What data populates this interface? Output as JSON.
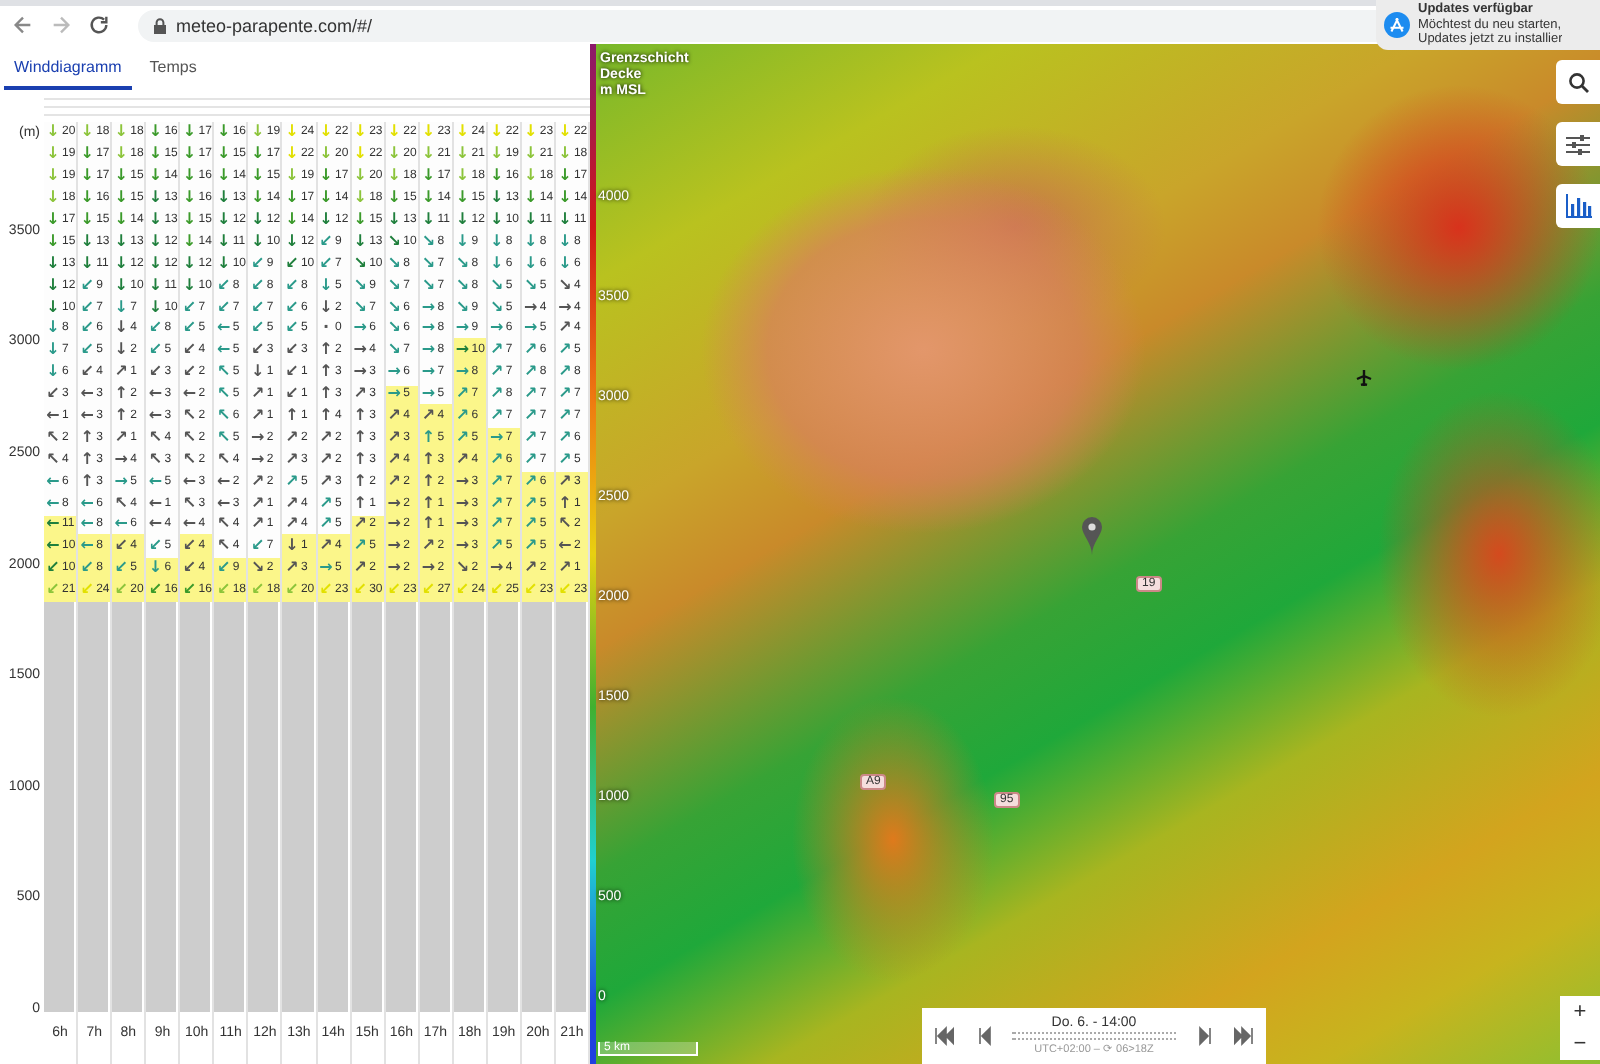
{
  "browser": {
    "url": "meteo-parapente.com/#/"
  },
  "notification": {
    "title": "Updates verfügbar",
    "lines": [
      "Möchtest du neu starten,",
      "Updates jetzt zu installier"
    ]
  },
  "wind_diagram": {
    "tabs": [
      {
        "label": "Winddiagramm",
        "selected": true
      },
      {
        "label": "Temps",
        "selected": false
      }
    ],
    "unit": "(m)",
    "y_ticks": [
      "3500",
      "3000",
      "2500",
      "2000",
      "1500",
      "1000",
      "500",
      "0"
    ],
    "columns": [
      {
        "hour": "6h",
        "level": 0.18
      },
      {
        "hour": "7h",
        "level": 0.14
      },
      {
        "hour": "8h",
        "level": 0.14
      },
      {
        "hour": "9h",
        "level": 0.09
      },
      {
        "hour": "10h",
        "level": 0.14
      },
      {
        "hour": "11h",
        "level": 0.09
      },
      {
        "hour": "12h",
        "level": 0.09
      },
      {
        "hour": "13h",
        "level": 0.14
      },
      {
        "hour": "14h",
        "level": 0.14
      },
      {
        "hour": "15h",
        "level": 0.18
      },
      {
        "hour": "16h",
        "level": 0.45
      },
      {
        "hour": "17h",
        "level": 0.41
      },
      {
        "hour": "18h",
        "level": 0.55
      },
      {
        "hour": "19h",
        "level": 0.36
      },
      {
        "hour": "20h",
        "level": 0.27
      },
      {
        "hour": "21h",
        "level": 0.27
      }
    ],
    "rows": [
      {
        "values": [
          "20",
          "18",
          "18",
          "16",
          "17",
          "16",
          "19",
          "24",
          "22",
          "23",
          "22",
          "23",
          "24",
          "22",
          "23",
          "22"
        ],
        "arrows": [
          "↓",
          "↓",
          "↓",
          "↓",
          "↓",
          "↓",
          "↓",
          "↓",
          "↓",
          "↓",
          "↓",
          "↓",
          "↓",
          "↓",
          "↓",
          "↓"
        ]
      },
      {
        "values": [
          "19",
          "17",
          "18",
          "15",
          "17",
          "15",
          "17",
          "22",
          "20",
          "22",
          "20",
          "21",
          "21",
          "19",
          "21",
          "18"
        ],
        "arrows": [
          "↓",
          "↓",
          "↓",
          "↓",
          "↓",
          "↓",
          "↓",
          "↓",
          "↓",
          "↓",
          "↓",
          "↓",
          "↓",
          "↓",
          "↓",
          "↓"
        ]
      },
      {
        "values": [
          "19",
          "17",
          "15",
          "14",
          "16",
          "14",
          "15",
          "19",
          "17",
          "20",
          "18",
          "17",
          "18",
          "16",
          "18",
          "17"
        ],
        "arrows": [
          "↓",
          "↓",
          "↓",
          "↓",
          "↓",
          "↓",
          "↓",
          "↓",
          "↓",
          "↓",
          "↓",
          "↓",
          "↓",
          "↓",
          "↓",
          "↓"
        ]
      },
      {
        "values": [
          "18",
          "16",
          "15",
          "13",
          "16",
          "13",
          "14",
          "17",
          "14",
          "18",
          "15",
          "14",
          "15",
          "13",
          "14",
          "14"
        ],
        "arrows": [
          "↓",
          "↓",
          "↓",
          "↓",
          "↓",
          "↓",
          "↓",
          "↓",
          "↓",
          "↓",
          "↓",
          "↓",
          "↓",
          "↓",
          "↓",
          "↓"
        ]
      },
      {
        "values": [
          "17",
          "15",
          "14",
          "13",
          "15",
          "12",
          "12",
          "14",
          "12",
          "15",
          "13",
          "11",
          "12",
          "10",
          "11",
          "11"
        ],
        "arrows": [
          "↓",
          "↓",
          "↓",
          "↓",
          "↓",
          "↓",
          "↓",
          "↓",
          "↓",
          "↓",
          "↓",
          "↓",
          "↓",
          "↓",
          "↓",
          "↓"
        ]
      },
      {
        "values": [
          "15",
          "13",
          "13",
          "12",
          "14",
          "11",
          "10",
          "12",
          "9",
          "13",
          "10",
          "8",
          "9",
          "8",
          "8",
          "8"
        ],
        "arrows": [
          "↓",
          "↓",
          "↓",
          "↓",
          "↓",
          "↓",
          "↓",
          "↓",
          "↙",
          "↓",
          "↘",
          "↘",
          "↓",
          "↓",
          "↓",
          "↓"
        ]
      },
      {
        "values": [
          "13",
          "11",
          "12",
          "12",
          "12",
          "10",
          "9",
          "10",
          "7",
          "10",
          "8",
          "7",
          "8",
          "6",
          "6",
          "6"
        ],
        "arrows": [
          "↓",
          "↓",
          "↓",
          "↓",
          "↓",
          "↓",
          "↙",
          "↙",
          "↙",
          "↘",
          "↘",
          "↘",
          "↘",
          "↓",
          "↓",
          "↓"
        ]
      },
      {
        "values": [
          "12",
          "9",
          "10",
          "11",
          "10",
          "8",
          "8",
          "8",
          "5",
          "9",
          "7",
          "7",
          "8",
          "5",
          "5",
          "4"
        ],
        "arrows": [
          "↓",
          "↙",
          "↓",
          "↓",
          "↓",
          "↙",
          "↙",
          "↙",
          "↓",
          "↘",
          "↘",
          "↘",
          "↘",
          "↘",
          "↘",
          "↘"
        ]
      },
      {
        "values": [
          "10",
          "7",
          "7",
          "10",
          "7",
          "7",
          "7",
          "6",
          "2",
          "7",
          "6",
          "8",
          "9",
          "5",
          "4",
          "4"
        ],
        "arrows": [
          "↓",
          "↙",
          "↓",
          "↓",
          "↙",
          "↙",
          "↙",
          "↙",
          "↓",
          "↘",
          "↘",
          "→",
          "↘",
          "↘",
          "→",
          "→"
        ]
      },
      {
        "values": [
          "8",
          "6",
          "4",
          "8",
          "5",
          "5",
          "5",
          "5",
          "0",
          "6",
          "6",
          "8",
          "9",
          "6",
          "5",
          "4"
        ],
        "arrows": [
          "↓",
          "↙",
          "↓",
          "↙",
          "↙",
          "←",
          "↙",
          "↙",
          "·",
          "→",
          "↘",
          "→",
          "→",
          "→",
          "→",
          "↗"
        ]
      },
      {
        "values": [
          "7",
          "5",
          "2",
          "5",
          "4",
          "5",
          "3",
          "3",
          "2",
          "4",
          "7",
          "8",
          "10",
          "7",
          "6",
          "5"
        ],
        "arrows": [
          "↓",
          "↙",
          "↓",
          "↙",
          "↙",
          "←",
          "↙",
          "↙",
          "↑",
          "→",
          "↘",
          "→",
          "→",
          "↗",
          "↗",
          "↗"
        ]
      },
      {
        "values": [
          "6",
          "4",
          "1",
          "3",
          "2",
          "5",
          "1",
          "1",
          "3",
          "3",
          "6",
          "7",
          "8",
          "7",
          "8",
          "8"
        ],
        "arrows": [
          "↓",
          "↙",
          "↗",
          "↙",
          "↙",
          "↖",
          "↓",
          "↙",
          "↑",
          "→",
          "→",
          "→",
          "→",
          "↗",
          "↗",
          "↗"
        ]
      },
      {
        "values": [
          "3",
          "3",
          "2",
          "3",
          "2",
          "5",
          "1",
          "1",
          "3",
          "3",
          "5",
          "5",
          "7",
          "8",
          "7",
          "7"
        ],
        "arrows": [
          "↙",
          "←",
          "↑",
          "←",
          "←",
          "↖",
          "↗",
          "↙",
          "↑",
          "↗",
          "→",
          "→",
          "↗",
          "↗",
          "↗",
          "↗"
        ]
      },
      {
        "values": [
          "1",
          "3",
          "2",
          "3",
          "2",
          "6",
          "1",
          "1",
          "4",
          "3",
          "4",
          "4",
          "6",
          "7",
          "7",
          "7"
        ],
        "arrows": [
          "←",
          "←",
          "↑",
          "←",
          "↖",
          "↖",
          "↗",
          "↑",
          "↑",
          "↑",
          "↗",
          "↗",
          "↗",
          "↗",
          "↗",
          "↗"
        ]
      },
      {
        "values": [
          "2",
          "3",
          "1",
          "4",
          "2",
          "5",
          "2",
          "2",
          "2",
          "3",
          "3",
          "5",
          "5",
          "7",
          "7",
          "6"
        ],
        "arrows": [
          "↖",
          "↑",
          "↗",
          "↖",
          "↖",
          "↖",
          "→",
          "↗",
          "↗",
          "↑",
          "↗",
          "↑",
          "↗",
          "→",
          "↗",
          "↗"
        ]
      },
      {
        "values": [
          "4",
          "3",
          "4",
          "3",
          "2",
          "4",
          "2",
          "3",
          "2",
          "3",
          "4",
          "3",
          "4",
          "6",
          "7",
          "5"
        ],
        "arrows": [
          "↖",
          "↑",
          "→",
          "↖",
          "↖",
          "↖",
          "→",
          "↗",
          "↗",
          "↑",
          "↗",
          "↑",
          "↗",
          "↗",
          "↗",
          "↗"
        ]
      },
      {
        "values": [
          "6",
          "3",
          "5",
          "5",
          "3",
          "2",
          "2",
          "5",
          "3",
          "2",
          "2",
          "2",
          "3",
          "7",
          "6",
          "3"
        ],
        "arrows": [
          "←",
          "↑",
          "→",
          "←",
          "←",
          "←",
          "↗",
          "↗",
          "↗",
          "↑",
          "↗",
          "↑",
          "→",
          "↗",
          "↗",
          "↗"
        ]
      },
      {
        "values": [
          "8",
          "6",
          "4",
          "1",
          "3",
          "3",
          "1",
          "4",
          "5",
          "1",
          "2",
          "1",
          "3",
          "7",
          "5",
          "1"
        ],
        "arrows": [
          "←",
          "←",
          "↖",
          "←",
          "↖",
          "←",
          "↗",
          "↗",
          "↗",
          "↑",
          "→",
          "↑",
          "→",
          "↗",
          "↗",
          "↑"
        ]
      },
      {
        "values": [
          "11",
          "8",
          "6",
          "4",
          "4",
          "4",
          "1",
          "4",
          "5",
          "2",
          "2",
          "1",
          "3",
          "7",
          "5",
          "2"
        ],
        "arrows": [
          "←",
          "←",
          "←",
          "←",
          "←",
          "↖",
          "↗",
          "↗",
          "↗",
          "↗",
          "→",
          "↑",
          "→",
          "↗",
          "↗",
          "↖"
        ]
      },
      {
        "values": [
          "10",
          "8",
          "4",
          "5",
          "4",
          "4",
          "7",
          "1",
          "4",
          "5",
          "2",
          "2",
          "3",
          "5",
          "5",
          "2"
        ],
        "arrows": [
          "←",
          "←",
          "↙",
          "↙",
          "↙",
          "↖",
          "↙",
          "↓",
          "↗",
          "↗",
          "→",
          "↗",
          "→",
          "↗",
          "↗",
          "←"
        ]
      },
      {
        "values": [
          "10",
          "8",
          "5",
          "6",
          "4",
          "9",
          "2",
          "3",
          "5",
          "2",
          "2",
          "2",
          "2",
          "4",
          "2",
          "1"
        ],
        "arrows": [
          "↙",
          "↙",
          "↙",
          "↓",
          "↙",
          "↙",
          "↘",
          "↗",
          "→",
          "↗",
          "→",
          "→",
          "↘",
          "→",
          "↗",
          "↗"
        ]
      },
      {
        "values": [
          "21",
          "24",
          "20",
          "16",
          "16",
          "18",
          "18",
          "20",
          "23",
          "30",
          "23",
          "27",
          "24",
          "25",
          "23",
          "23"
        ],
        "arrows": [
          "↙",
          "↙",
          "↙",
          "↙",
          "↙",
          "↙",
          "↙",
          "↙",
          "↙",
          "↙",
          "↙",
          "↙",
          "↙",
          "↙",
          "↙",
          "↙"
        ]
      }
    ]
  },
  "map": {
    "legend_title": [
      "Grenzschicht",
      "Decke",
      "m MSL"
    ],
    "legend_ticks": [
      "4000",
      "3500",
      "3000",
      "2500",
      "2000",
      "1500",
      "1000",
      "500",
      "0"
    ],
    "road_signs": [
      {
        "label": "19"
      },
      {
        "label": "A9"
      },
      {
        "label": "95"
      }
    ],
    "scale": "5 km",
    "time": {
      "label": "Do. 6. - 14:00",
      "sub": "UTC+02:00 – ⟳ 06>18Z"
    },
    "zoom": [
      "+",
      "−"
    ]
  }
}
